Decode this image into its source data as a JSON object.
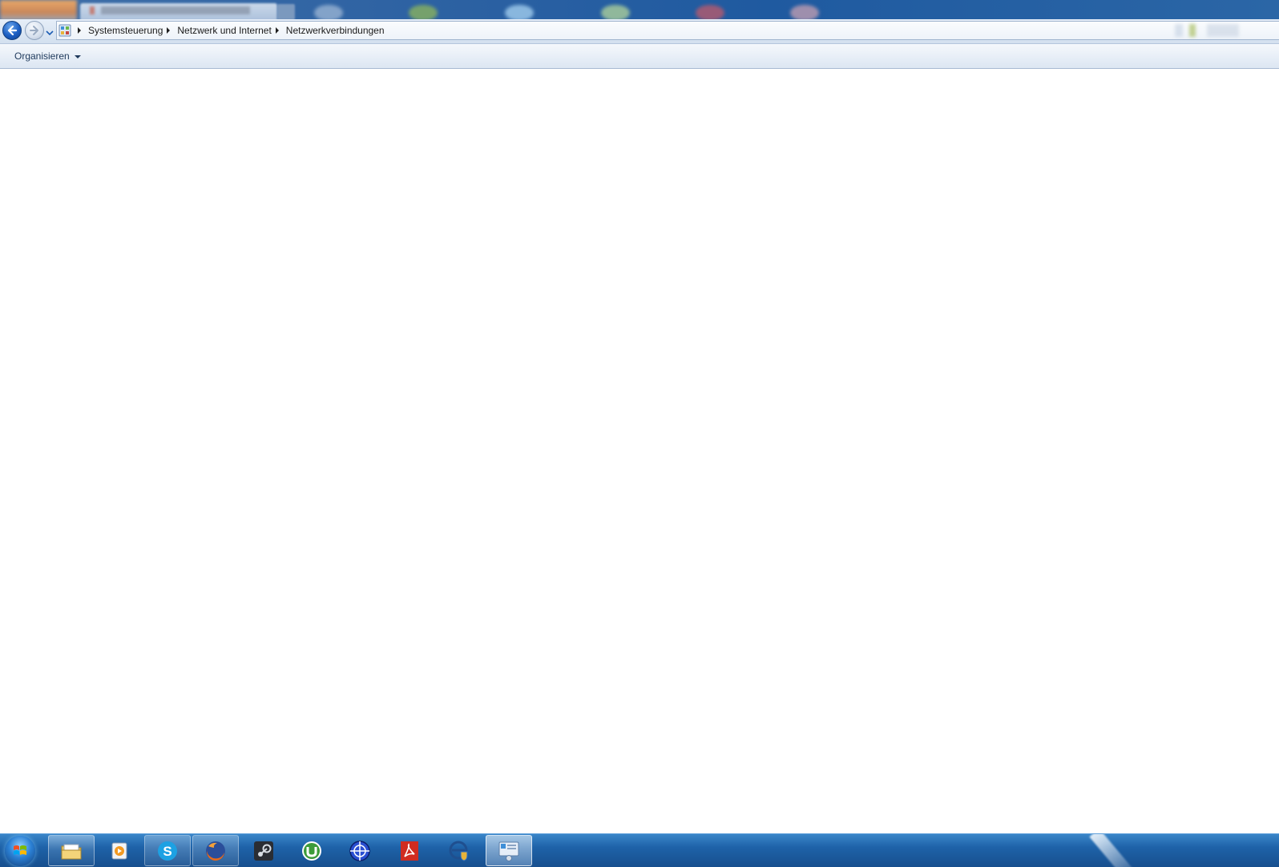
{
  "window": {
    "breadcrumbs": [
      {
        "label": "Systemsteuerung"
      },
      {
        "label": "Netzwerk und Internet"
      },
      {
        "label": "Netzwerkverbindungen"
      }
    ],
    "address_icon": "control-panel-icon"
  },
  "command_bar": {
    "organize_label": "Organisieren"
  },
  "taskbar": {
    "start_icon": "windows-start-orb-icon",
    "items": [
      {
        "icon": "file-explorer-icon",
        "state": "pinned-active"
      },
      {
        "icon": "media-player-icon",
        "state": "pinned"
      },
      {
        "icon": "skype-icon",
        "state": "open"
      },
      {
        "icon": "firefox-icon",
        "state": "open"
      },
      {
        "icon": "steam-icon",
        "state": "pinned"
      },
      {
        "icon": "utorrent-icon",
        "state": "pinned"
      },
      {
        "icon": "crosshair-app-icon",
        "state": "pinned"
      },
      {
        "icon": "adobe-reader-icon",
        "state": "pinned"
      },
      {
        "icon": "internet-options-icon",
        "state": "pinned"
      },
      {
        "icon": "network-connections-icon",
        "state": "focused"
      }
    ]
  },
  "colors": {
    "taskbar": "#1e62a8",
    "address_bar": "#e6eef8",
    "command_bar": "#e7eef7",
    "content": "#ffffff",
    "link_text": "#1e395b"
  }
}
